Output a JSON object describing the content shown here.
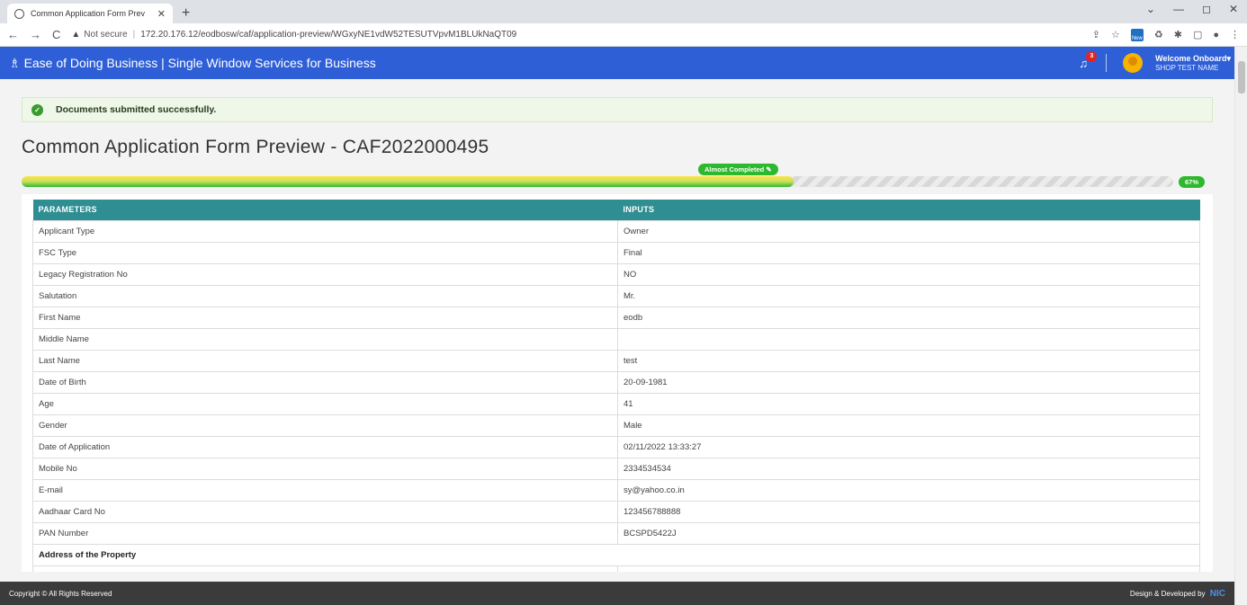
{
  "browser": {
    "tab_title": "Common Application Form Prev",
    "tab_close": "✕",
    "new_tab": "+",
    "window_controls": [
      "⌄",
      "—",
      "◻",
      "✕"
    ],
    "not_secure": "Not secure",
    "url": "172.20.176.12/eodbosw/caf/application-preview/WGxyNE1vdW52TESUTVpvM1BLUkNaQT09",
    "ext_new": "New"
  },
  "header": {
    "brand": "Ease of Doing Business | Single Window Services for Business",
    "notification_count": "3",
    "welcome": "Welcome Onboard▾",
    "user_name": "SHOP TEST NAME"
  },
  "alert": {
    "message": "Documents submitted successfully."
  },
  "page": {
    "title": "Common Application Form Preview - CAF2022000495"
  },
  "progress": {
    "label": "Almost Completed ✎",
    "percent_label": "67%",
    "value": 0.67
  },
  "table": {
    "headers": [
      "PARAMETERS",
      "INPUTS"
    ],
    "rows": [
      {
        "param": "Applicant Type",
        "input": "Owner"
      },
      {
        "param": "FSC Type",
        "input": "Final"
      },
      {
        "param": "Legacy Registration No",
        "input": "NO"
      },
      {
        "param": "Salutation",
        "input": "Mr."
      },
      {
        "param": "First Name",
        "input": "eodb"
      },
      {
        "param": "Middle Name",
        "input": ""
      },
      {
        "param": "Last Name",
        "input": "test"
      },
      {
        "param": "Date of Birth",
        "input": "20-09-1981"
      },
      {
        "param": "Age",
        "input": "41"
      },
      {
        "param": "Gender",
        "input": "Male"
      },
      {
        "param": "Date of Application",
        "input": "02/11/2022 13:33:27"
      },
      {
        "param": "Mobile No",
        "input": "2334534534"
      },
      {
        "param": "E-mail",
        "input": "sy@yahoo.co.in"
      },
      {
        "param": "Aadhaar Card No",
        "input": "123456788888"
      },
      {
        "param": "PAN Number",
        "input": "BCSPD5422J"
      }
    ],
    "section_heading": "Address of the Property"
  },
  "footer": {
    "copyright": "Copyright © All Rights Reserved",
    "designed_by": "Design & Developed by",
    "nic": "NIC"
  },
  "colors": {
    "header_bg": "#2f5fd6",
    "table_header_bg": "#2e8e92",
    "progress_green": "#2eb82e",
    "alert_bg": "#eef7e8"
  }
}
